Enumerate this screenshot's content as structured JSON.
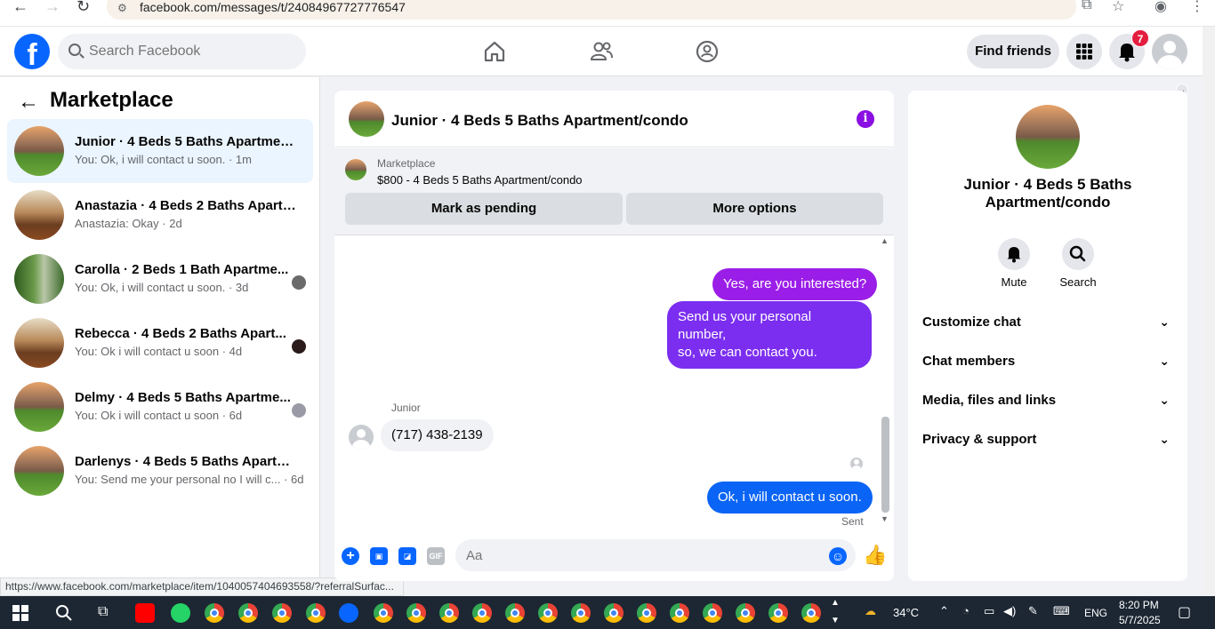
{
  "browser": {
    "url": "facebook.com/messages/t/24084967727776547"
  },
  "topbar": {
    "search_placeholder": "Search Facebook",
    "find_friends_label": "Find friends",
    "notification_count": "7"
  },
  "left_panel": {
    "title": "Marketplace",
    "conversations": [
      {
        "name": "Junior · 4 Beds 5 Baths Apartment...",
        "preview": "You: Ok, i will contact u soon. · 1m",
        "thumb": "house"
      },
      {
        "name": "Anastazia · 4 Beds 2 Baths Apartm...",
        "preview": "Anastazia: Okay · 2d",
        "thumb": "room"
      },
      {
        "name": "Carolla · 2 Beds 1 Bath Apartme...",
        "preview": "You: Ok, i will contact u soon. · 3d",
        "thumb": "yard"
      },
      {
        "name": "Rebecca · 4 Beds 2 Baths Apart...",
        "preview": "You: Ok i will contact u soon · 4d",
        "thumb": "room"
      },
      {
        "name": "Delmy · 4 Beds 5 Baths Apartme...",
        "preview": "You: Ok i will contact u soon · 6d",
        "thumb": "house"
      },
      {
        "name": "Darlenys · 4 Beds 5 Baths Apartme...",
        "preview": "You: Send me your personal no I will c... · 6d",
        "thumb": "house"
      }
    ]
  },
  "status_bar": {
    "link": "https://www.facebook.com/marketplace/item/1040057404693558/?referralSurfac..."
  },
  "chat": {
    "title": "Junior · 4 Beds 5 Baths Apartment/condo",
    "listing_source": "Marketplace",
    "listing_desc": "$800 - 4 Beds 5 Baths Apartment/condo",
    "mark_pending_label": "Mark as pending",
    "more_options_label": "More options",
    "messages": {
      "out_1": "Yes, are you interested?",
      "out_2_line1": "Send us your personal number,",
      "out_2_line2": "so, we can contact you.",
      "sender_name": "Junior",
      "in_1": "(717) 438-2139",
      "out_3": "Ok, i will contact u soon.",
      "sent_status": "Sent"
    },
    "composer_placeholder": "Aa",
    "gif_label": "GIF"
  },
  "right_panel": {
    "name": "Junior · 4 Beds 5 Baths Apartment/condo",
    "mute_label": "Mute",
    "search_label": "Search",
    "rows": [
      "Customize chat",
      "Chat members",
      "Media, files and links",
      "Privacy & support"
    ]
  },
  "taskbar": {
    "temperature": "34°C",
    "language": "ENG",
    "time": "8:20 PM",
    "date": "5/7/2025"
  }
}
